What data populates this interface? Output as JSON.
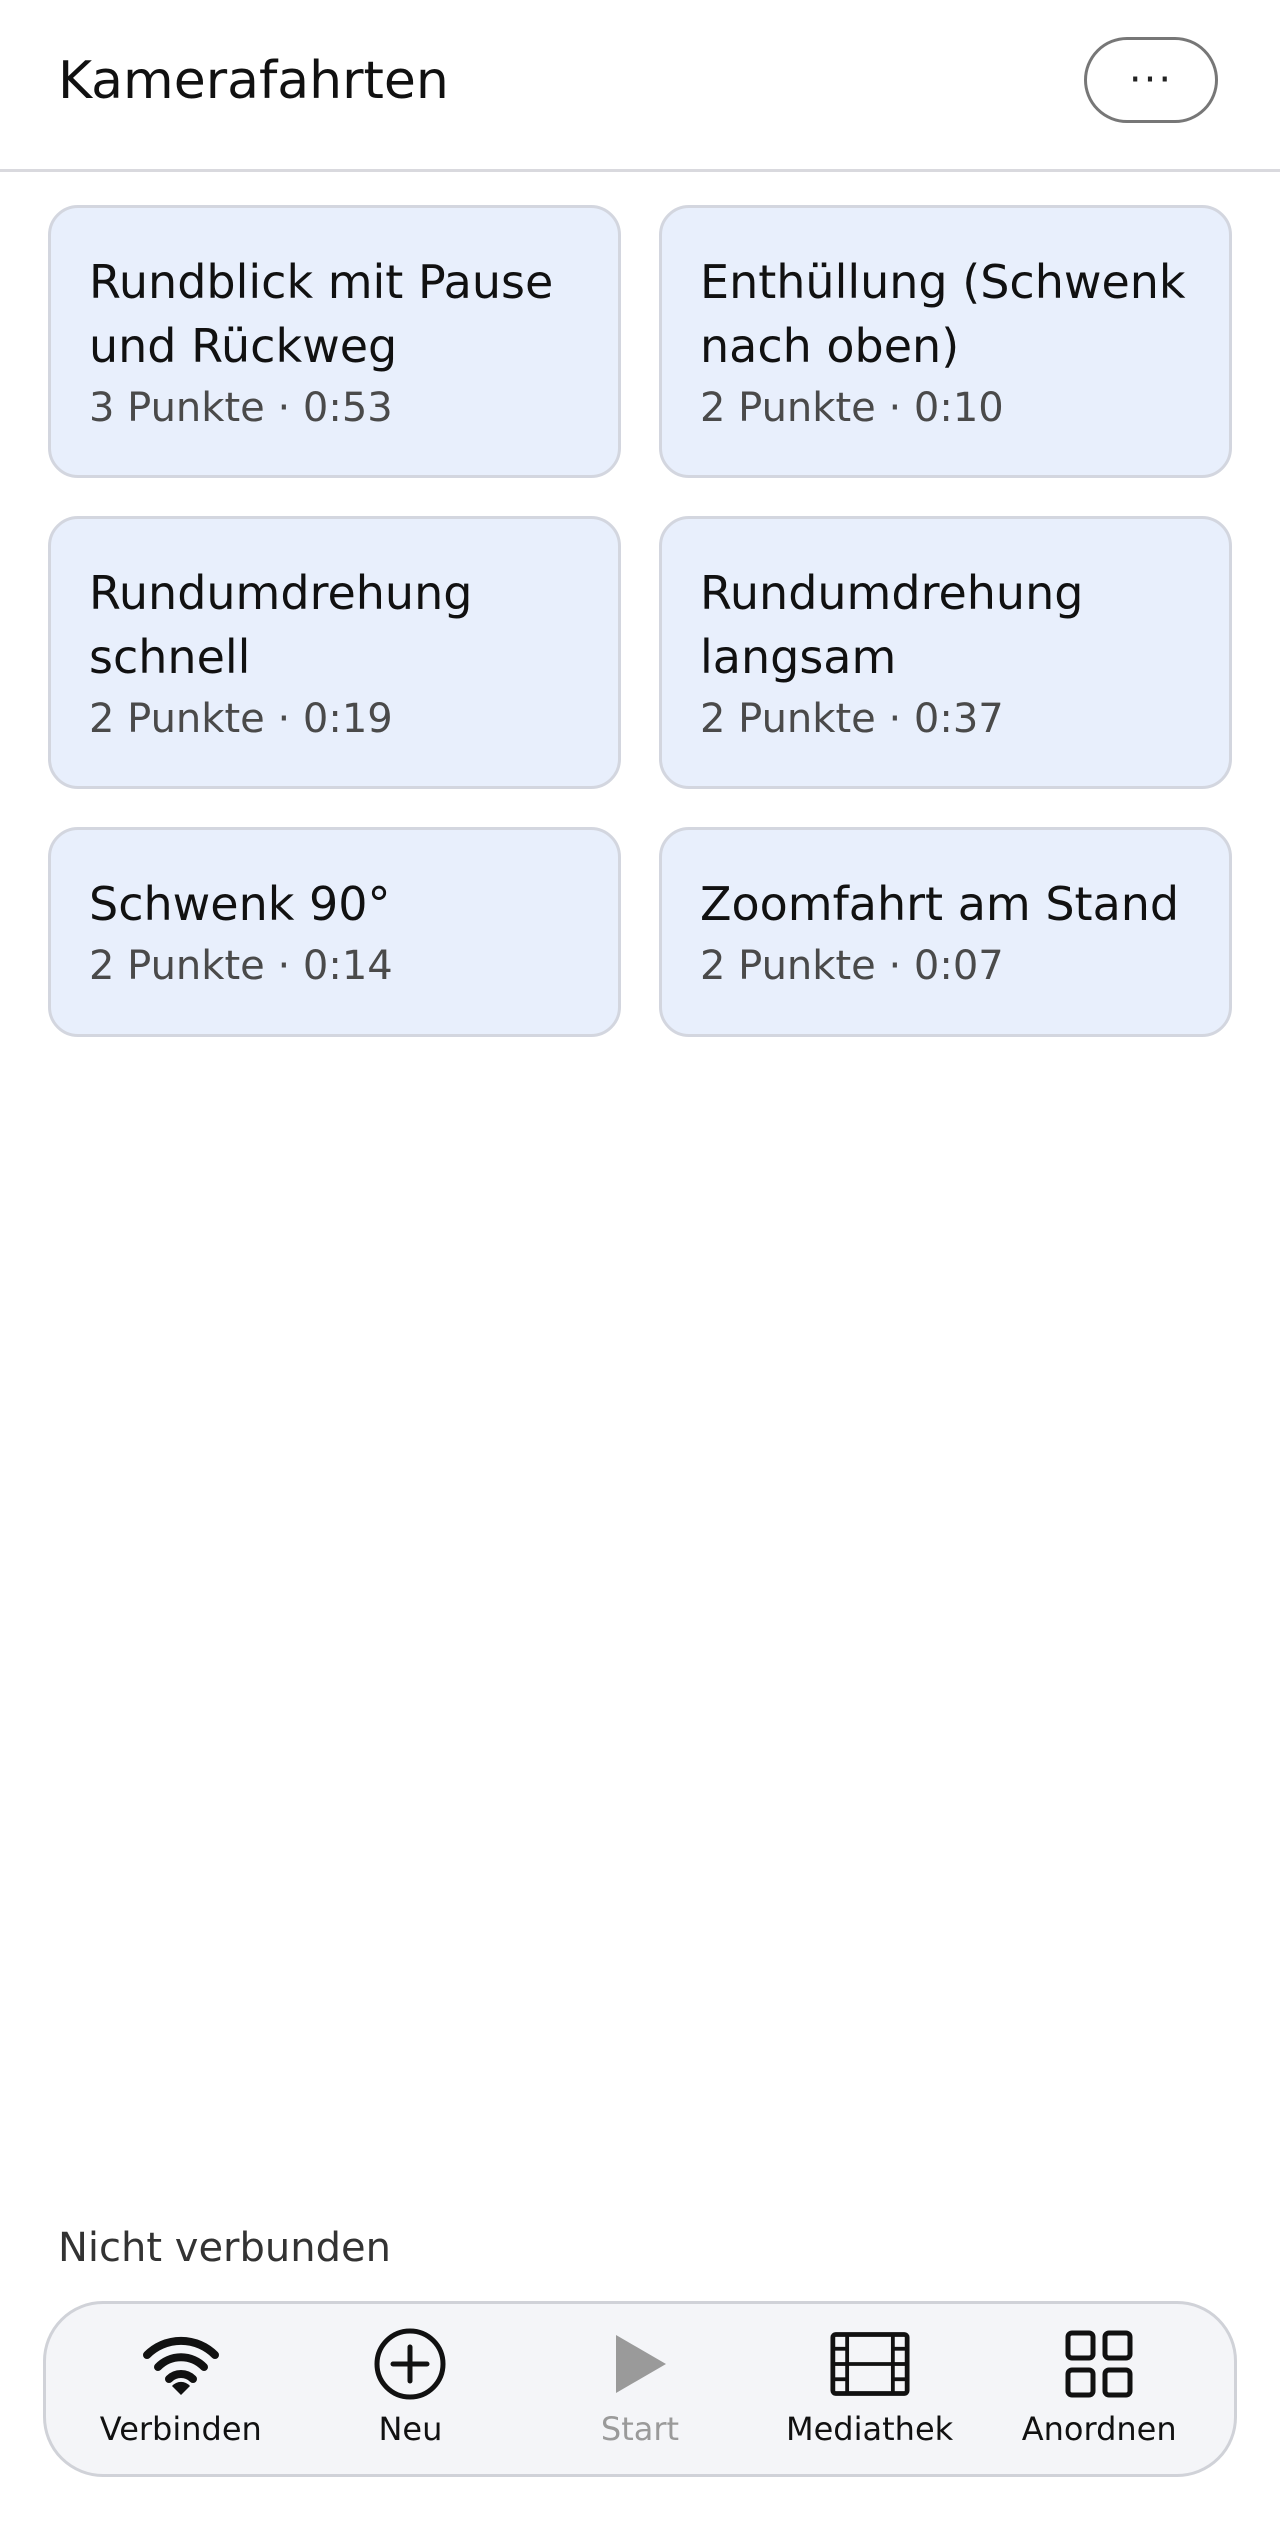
{
  "header": {
    "title": "Kamerafahrten",
    "more_label": "···"
  },
  "sequences": [
    {
      "title": "Rundblick mit Pause und Rückweg",
      "meta": "3 Punkte · 0:53"
    },
    {
      "title": "Enthüllung (Schwenk nach oben)",
      "meta": "2 Punkte · 0:10"
    },
    {
      "title": "Rundumdrehung schnell",
      "meta": "2 Punkte · 0:19"
    },
    {
      "title": "Rundumdrehung langsam",
      "meta": "2 Punkte · 0:37"
    },
    {
      "title": "Schwenk 90°",
      "meta": "2 Punkte · 0:14"
    },
    {
      "title": "Zoomfahrt am Stand",
      "meta": "2 Punkte · 0:07"
    }
  ],
  "status": {
    "connection": "Nicht verbunden"
  },
  "tabbar": {
    "items": [
      {
        "label": "Verbinden",
        "icon": "wifi-icon",
        "enabled": true
      },
      {
        "label": "Neu",
        "icon": "plus-circle-icon",
        "enabled": true
      },
      {
        "label": "Start",
        "icon": "play-icon",
        "enabled": false
      },
      {
        "label": "Mediathek",
        "icon": "film-icon",
        "enabled": true
      },
      {
        "label": "Anordnen",
        "icon": "grid-icon",
        "enabled": true
      }
    ]
  },
  "colors": {
    "card_background": "#e8effc",
    "card_border": "#d3d6df",
    "disabled": "#9a9a9a"
  }
}
